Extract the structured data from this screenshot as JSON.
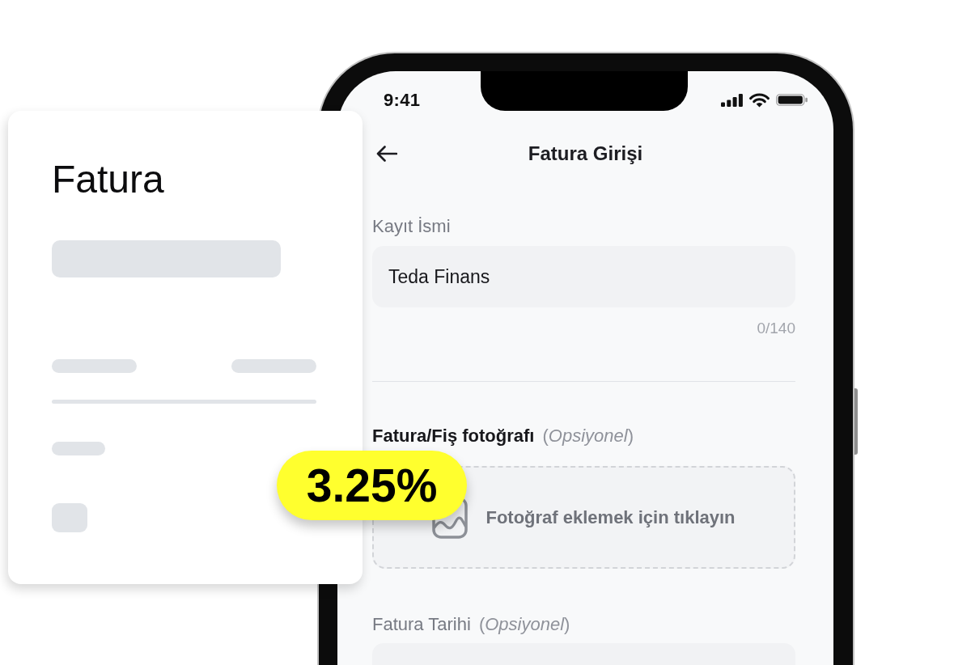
{
  "phone": {
    "status_bar": {
      "time": "9:41"
    },
    "header": {
      "title": "Fatura Girişi"
    },
    "form": {
      "fields": [
        {
          "kind": "text",
          "label": "Kayıt İsmi",
          "value": "Teda Finans",
          "counter": "0/140"
        },
        {
          "kind": "divider"
        },
        {
          "kind": "photo",
          "label": "Fatura/Fiş fotoğrafı",
          "note": "(*Opsiyonel*)",
          "prompt": "Fotoğraf eklemek için tıklayın"
        },
        {
          "kind": "date",
          "label": "Fatura Tarihi",
          "note": "(*Opsiyonel*)"
        }
      ]
    }
  },
  "invoice_card": {
    "title": "Fatura"
  },
  "rate_badge": {
    "text": "3.25%"
  }
}
